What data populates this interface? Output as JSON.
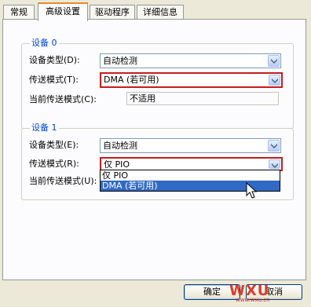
{
  "tabs": [
    "常规",
    "高级设置",
    "驱动程序",
    "详细信息"
  ],
  "active_tab": 1,
  "device0": {
    "title": "设备 0",
    "device_type_label": "设备类型(D):",
    "device_type_value": "自动检测",
    "transfer_mode_label": "传送模式(T):",
    "transfer_mode_value": "DMA (若可用)",
    "current_mode_label": "当前传送模式(C):",
    "current_mode_value": "不适用"
  },
  "device1": {
    "title": "设备 1",
    "device_type_label": "设备类型(E):",
    "device_type_value": "自动检测",
    "transfer_mode_label": "传送模式(R):",
    "transfer_mode_value": "仅 PIO",
    "current_mode_label": "当前传送模式(U):",
    "dropdown_options": [
      "仅 PIO",
      "DMA (若可用)"
    ],
    "dropdown_selected_index": 1
  },
  "buttons": {
    "ok": "确定",
    "cancel": "取消"
  },
  "watermark": {
    "text": "WXU",
    "sub": "www.wxu.cn"
  }
}
